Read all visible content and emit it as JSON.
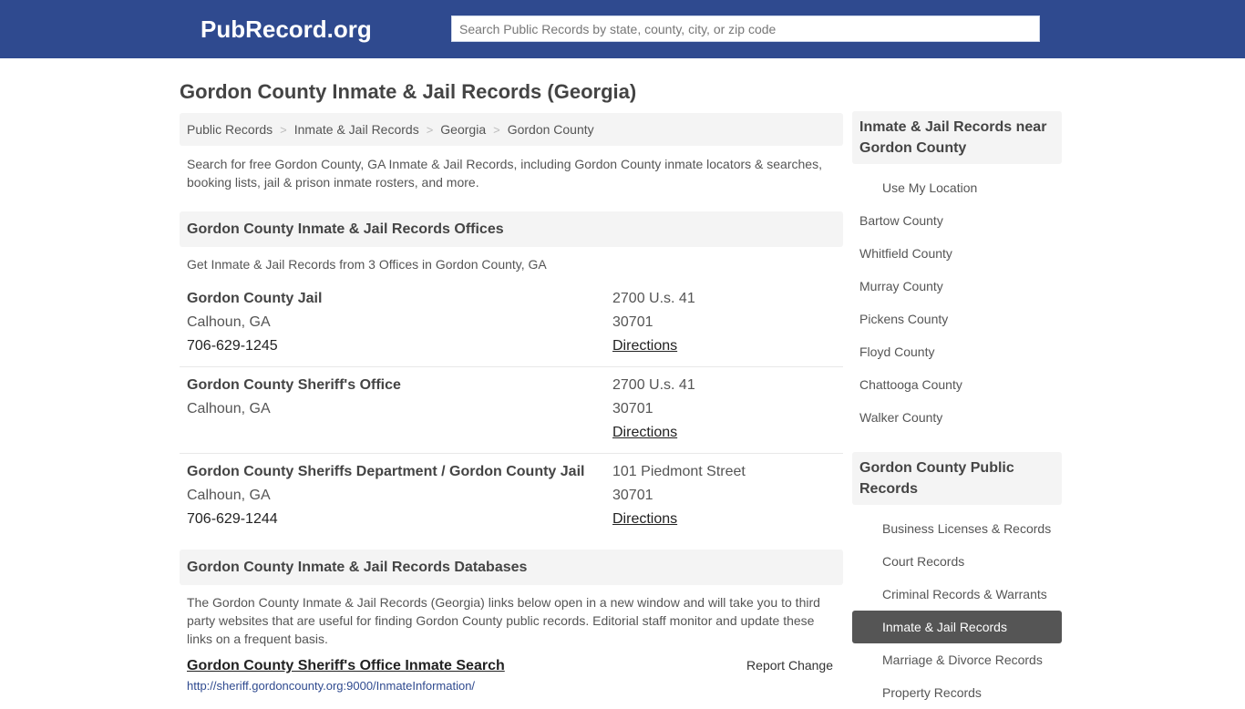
{
  "header": {
    "logo": "PubRecord.org",
    "search_placeholder": "Search Public Records by state, county, city, or zip code"
  },
  "page_title": "Gordon County Inmate & Jail Records (Georgia)",
  "breadcrumb": [
    {
      "label": "Public Records"
    },
    {
      "label": "Inmate & Jail Records"
    },
    {
      "label": "Georgia"
    },
    {
      "label": "Gordon County"
    }
  ],
  "breadcrumb_separator": ">",
  "intro": "Search for free Gordon County, GA Inmate & Jail Records, including Gordon County inmate locators & searches, booking lists, jail & prison inmate rosters, and more.",
  "offices_section": {
    "heading": "Gordon County Inmate & Jail Records Offices",
    "subtitle": "Get Inmate & Jail Records from 3 Offices in Gordon County, GA",
    "offices": [
      {
        "name": "Gordon County Jail",
        "city": "Calhoun, GA",
        "phone": "706-629-1245",
        "address": "2700 U.s. 41",
        "zip": "30701",
        "directions": "Directions"
      },
      {
        "name": "Gordon County Sheriff's Office",
        "city": "Calhoun, GA",
        "phone": "",
        "address": "2700 U.s. 41",
        "zip": "30701",
        "directions": "Directions"
      },
      {
        "name": "Gordon County Sheriffs Department / Gordon County Jail",
        "city": "Calhoun, GA",
        "phone": "706-629-1244",
        "address": "101 Piedmont Street",
        "zip": "30701",
        "directions": "Directions"
      }
    ]
  },
  "databases_section": {
    "heading": "Gordon County Inmate & Jail Records Databases",
    "description": "The Gordon County Inmate & Jail Records (Georgia) links below open in a new window and will take you to third party websites that are useful for finding Gordon County public records. Editorial staff monitor and update these links on a frequent basis.",
    "links": [
      {
        "title": "Gordon County Sheriff's Office Inmate Search",
        "report": "Report Change",
        "url": "http://sheriff.gordoncounty.org:9000/InmateInformation/"
      }
    ]
  },
  "sidebar": {
    "nearby": {
      "heading": "Inmate & Jail Records near Gordon County",
      "use_location": "Use My Location",
      "items": [
        "Bartow County",
        "Whitfield County",
        "Murray County",
        "Pickens County",
        "Floyd County",
        "Chattooga County",
        "Walker County"
      ]
    },
    "public_records": {
      "heading": "Gordon County Public Records",
      "items": [
        {
          "label": "Business Licenses & Records",
          "active": false
        },
        {
          "label": "Court Records",
          "active": false
        },
        {
          "label": "Criminal Records & Warrants",
          "active": false
        },
        {
          "label": "Inmate & Jail Records",
          "active": true
        },
        {
          "label": "Marriage & Divorce Records",
          "active": false
        },
        {
          "label": "Property Records",
          "active": false
        }
      ]
    }
  },
  "colors": {
    "header_bg": "#2f4a8f",
    "panel_bg": "#f4f4f4",
    "active_bg": "#555555"
  }
}
